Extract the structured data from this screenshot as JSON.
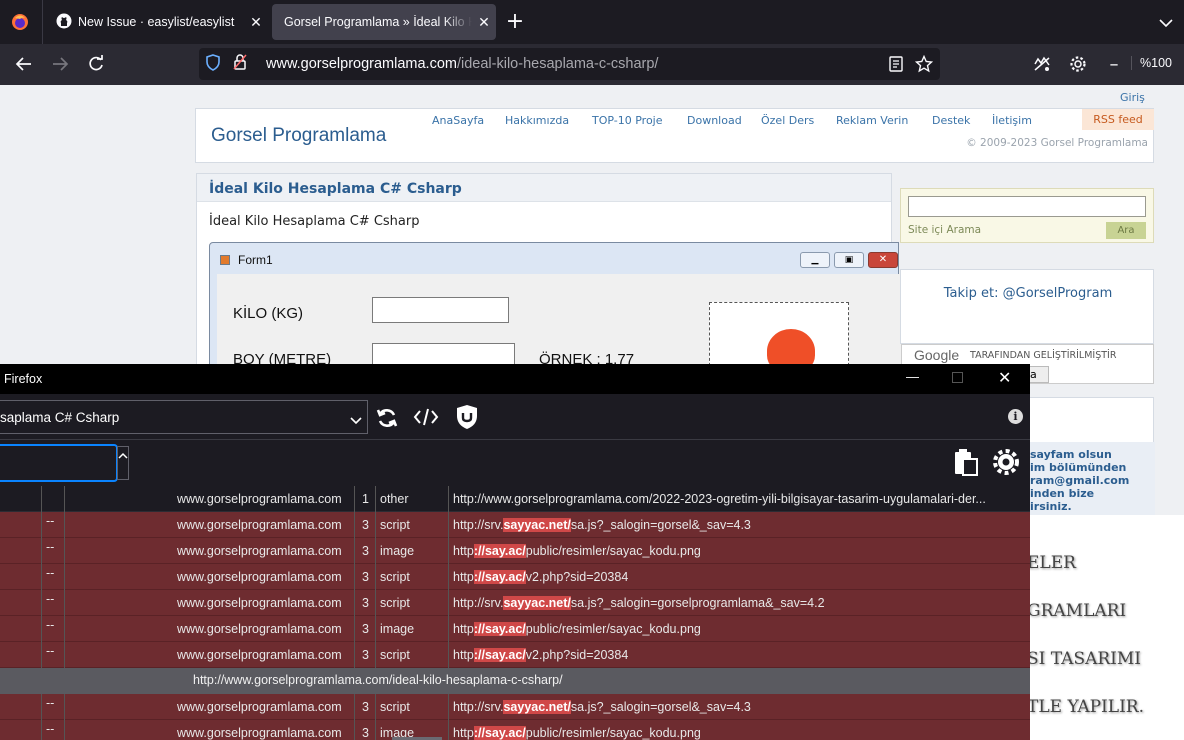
{
  "browser": {
    "tabs": [
      {
        "title": "New Issue · easylist/easylist",
        "active": false
      },
      {
        "title": "Gorsel Programlama » İdeal Kilo Hesaplama C# Csharp",
        "active": true
      }
    ],
    "url_domain": "www.gorselprogramlama.com",
    "url_path": "/ideal-kilo-hesaplama-c-csharp/",
    "zoom": "%100"
  },
  "site": {
    "login": "Giriş",
    "logo": "Gorsel Programlama",
    "nav": [
      "AnaSayfa",
      "Hakkımızda",
      "TOP-10 Proje",
      "Download",
      "Özel Ders",
      "Reklam Verin",
      "Destek",
      "İletişim"
    ],
    "rss": "RSS feed",
    "copyright": "© 2009-2023 Gorsel Programlama",
    "post_title": "İdeal Kilo Hesaplama C# Csharp",
    "post_subtitle": "İdeal Kilo Hesaplama C# Csharp",
    "form": {
      "title": "Form1",
      "kilo_label": "KİLO (KG)",
      "boy_label": "BOY (METRE)",
      "ornek": "ÖRNEK : 1.77"
    },
    "sidebar": {
      "search_button": "Ara",
      "search_caption": "Site içi Arama",
      "follow": "Takip et: @GorselProgram",
      "google_logo": "Google",
      "google_caption": "TARAFINDAN GELİŞTİRİLMİŞTİR",
      "google_button": "a",
      "info_lines": [
        "sayfam olsun",
        "im bölümünden",
        "ram@gmail.com",
        "inden bize",
        "irsiniz."
      ],
      "big_lines": [
        "ELER",
        "GRAMLARI",
        "SI TASARIMI",
        "TLE YAPILIR."
      ]
    }
  },
  "logger": {
    "window_title": "Firefox",
    "tab_selector": "saplama C# Csharp",
    "rows": [
      {
        "type": "normal",
        "dash": "",
        "domain": "www.gorselprogramlama.com",
        "count": "1",
        "kind": "other",
        "pre": "http://www.gorselprogramlama.com/2022-2023-ogretim-yili-bilgisayar-tasarim-uygulamalari-der...",
        "hl": "",
        "post": ""
      },
      {
        "type": "blocked",
        "dash": "--",
        "domain": "www.gorselprogramlama.com",
        "count": "3",
        "kind": "script",
        "pre": "http://srv.",
        "hl": "sayyac.net/",
        "post": "sa.js?_salogin=gorsel&_sav=4.3"
      },
      {
        "type": "blocked",
        "dash": "--",
        "domain": "www.gorselprogramlama.com",
        "count": "3",
        "kind": "image",
        "pre": "http",
        "hl": "://say.ac/",
        "post": "public/resimler/sayac_kodu.png"
      },
      {
        "type": "blocked",
        "dash": "--",
        "domain": "www.gorselprogramlama.com",
        "count": "3",
        "kind": "script",
        "pre": "http",
        "hl": "://say.ac/",
        "post": "v2.php?sid=20384"
      },
      {
        "type": "blocked",
        "dash": "--",
        "domain": "www.gorselprogramlama.com",
        "count": "3",
        "kind": "script",
        "pre": "http://srv.",
        "hl": "sayyac.net/",
        "post": "sa.js?_salogin=gorselprogramlama&_sav=4.2"
      },
      {
        "type": "blocked",
        "dash": "--",
        "domain": "www.gorselprogramlama.com",
        "count": "3",
        "kind": "image",
        "pre": "http",
        "hl": "://say.ac/",
        "post": "public/resimler/sayac_kodu.png"
      },
      {
        "type": "blocked",
        "dash": "--",
        "domain": "www.gorselprogramlama.com",
        "count": "3",
        "kind": "script",
        "pre": "http",
        "hl": "://say.ac/",
        "post": "v2.php?sid=20384"
      },
      {
        "type": "separator",
        "url": "http://www.gorselprogramlama.com/ideal-kilo-hesaplama-c-csharp/"
      },
      {
        "type": "blocked",
        "dash": "--",
        "domain": "www.gorselprogramlama.com",
        "count": "3",
        "kind": "script",
        "pre": "http://srv.",
        "hl": "sayyac.net/",
        "post": "sa.js?_salogin=gorsel&_sav=4.3"
      },
      {
        "type": "blocked",
        "dash": "--",
        "domain": "www.gorselprogramlama.com",
        "count": "3",
        "kind": "image",
        "pre": "http",
        "hl": "://say.ac/",
        "post": "public/resimler/sayac_kodu.png"
      }
    ]
  },
  "colors": {
    "blocked_row": "#6e2c30",
    "highlight": "#d04848",
    "accent": "#3a73a8"
  }
}
